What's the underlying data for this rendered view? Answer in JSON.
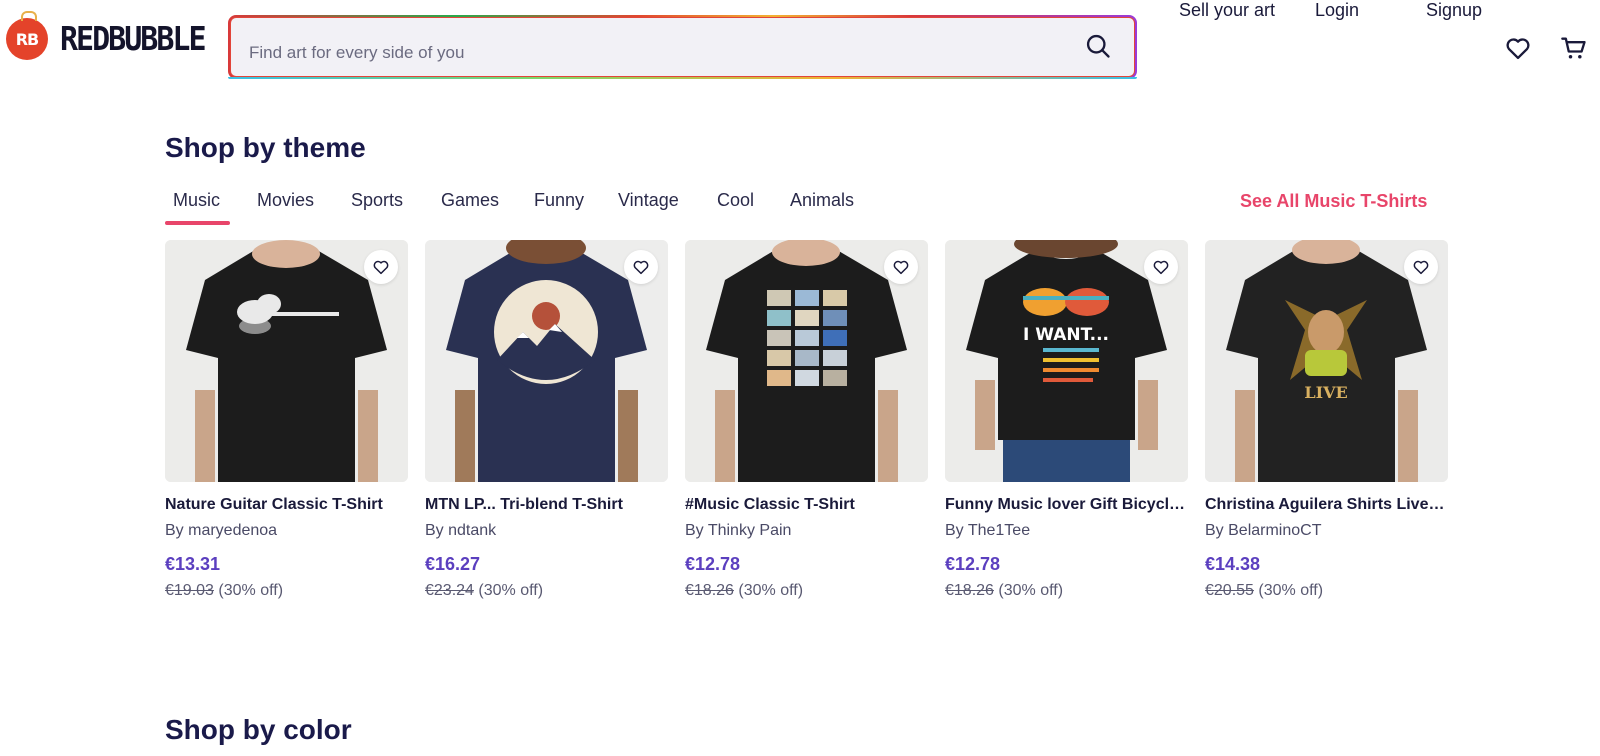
{
  "brand": {
    "badge_text": "RB",
    "name": "REDBUBBLE"
  },
  "search": {
    "placeholder": "Find art for every side of you"
  },
  "nav": {
    "sell": "Sell your art",
    "login": "Login",
    "signup": "Signup"
  },
  "theme_section": {
    "title": "Shop by theme",
    "tabs": [
      "Music",
      "Movies",
      "Sports",
      "Games",
      "Funny",
      "Vintage",
      "Cool",
      "Animals"
    ],
    "active_tab": "Music",
    "see_all": "See All Music T-Shirts"
  },
  "products": [
    {
      "title": "Nature Guitar Classic T-Shirt",
      "by": "By maryedenoa",
      "price": "€13.31",
      "old_price": "€19.03",
      "discount": "(30% off)",
      "shirt_color": "#1c1c1c",
      "art": "guitar"
    },
    {
      "title": "MTN LP... Tri-blend T-Shirt",
      "by": "By ndtank",
      "price": "€16.27",
      "old_price": "€23.24",
      "discount": "(30% off)",
      "shirt_color": "#2a3152",
      "art": "mountain-record"
    },
    {
      "title": "#Music Classic T-Shirt",
      "by": "By Thinky Pain",
      "price": "€12.78",
      "old_price": "€18.26",
      "discount": "(30% off)",
      "shirt_color": "#1c1c1c",
      "art": "cassettes"
    },
    {
      "title": "Funny Music lover Gift Bicycle ...",
      "by": "By The1Tee",
      "price": "€12.78",
      "old_price": "€18.26",
      "discount": "(30% off)",
      "shirt_color": "#1c1c1c",
      "art": "i-want"
    },
    {
      "title": "Christina Aguilera Shirts Live 2...",
      "by": "By BelarminoCT",
      "price": "€14.38",
      "old_price": "€20.55",
      "discount": "(30% off)",
      "shirt_color": "#222222",
      "art": "live-portrait"
    }
  ],
  "shirt_art_text": {
    "i_want": "I WANT...",
    "live": "LIVE"
  },
  "color_section": {
    "title": "Shop by color"
  },
  "colors": {
    "accent_pink": "#e8456a",
    "price_purple": "#5b3fbf",
    "brand_red": "#e4432a"
  }
}
